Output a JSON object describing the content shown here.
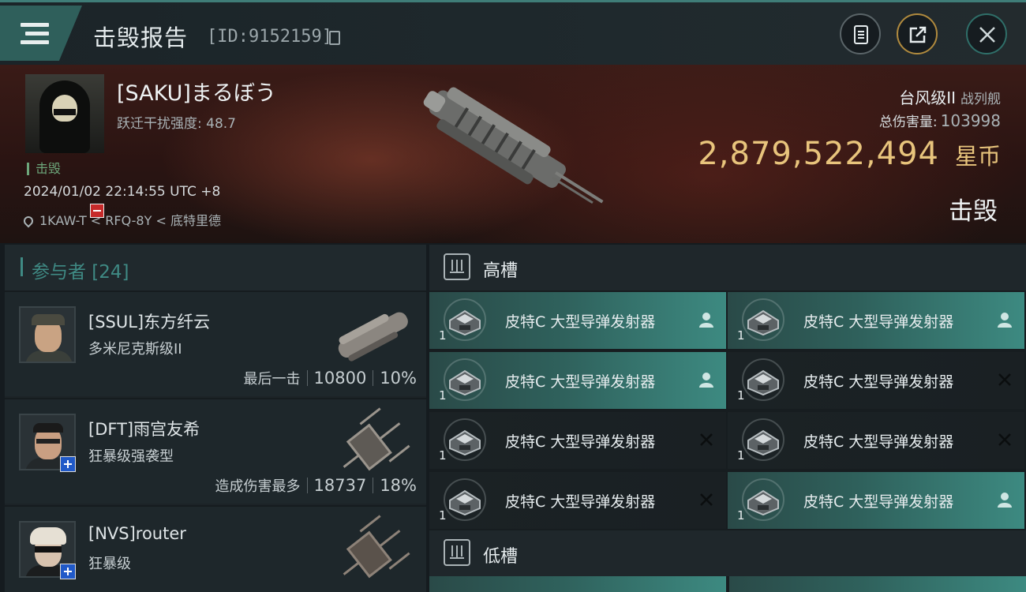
{
  "header": {
    "title": "击毁报告",
    "report_id": "[ID:9152159]",
    "buttons": [
      "clipboard-icon",
      "share-icon",
      "close-icon"
    ]
  },
  "victim": {
    "name": "[SAKU]まるぼう",
    "warp_scramble": "跃迁干扰强度: 48.7",
    "tag": "击毁",
    "timestamp": "2024/01/02 22:14:55 UTC +8",
    "location": "1KAW-T < RFQ-8Y < 底特里德",
    "ship_class": "台风级II",
    "ship_type": "战列舰",
    "total_damage_label": "总伤害量:",
    "total_damage": "103998",
    "isk_value": "2,879,522,494",
    "isk_unit": "星币",
    "status": "击毁"
  },
  "participants": {
    "header": "参与者 [24]",
    "items": [
      {
        "name": "[SSUL]东方纤云",
        "ship": "多米尼克斯级II",
        "label": "最后一击",
        "damage": "10800",
        "percent": "10%"
      },
      {
        "name": "[DFT]雨宫友希",
        "ship": "狂暴级强袭型",
        "label": "造成伤害最多",
        "damage": "18737",
        "percent": "18%"
      },
      {
        "name": "[NVS]router",
        "ship": "狂暴级",
        "label": "",
        "damage": "",
        "percent": ""
      }
    ]
  },
  "slots": {
    "high_label": "高槽",
    "low_label": "低槽",
    "high": [
      {
        "name": "皮特C 大型导弹发射器",
        "qty": "1",
        "state": "dropped"
      },
      {
        "name": "皮特C 大型导弹发射器",
        "qty": "1",
        "state": "dropped"
      },
      {
        "name": "皮特C 大型导弹发射器",
        "qty": "1",
        "state": "dropped"
      },
      {
        "name": "皮特C 大型导弹发射器",
        "qty": "1",
        "state": "destroyed"
      },
      {
        "name": "皮特C 大型导弹发射器",
        "qty": "1",
        "state": "destroyed"
      },
      {
        "name": "皮特C 大型导弹发射器",
        "qty": "1",
        "state": "destroyed"
      },
      {
        "name": "皮特C 大型导弹发射器",
        "qty": "1",
        "state": "destroyed"
      },
      {
        "name": "皮特C 大型导弹发射器",
        "qty": "1",
        "state": "dropped"
      }
    ]
  },
  "colors": {
    "accent": "#3f8a84",
    "isk": "#e8c47c",
    "kill_tag": "#6da77b"
  }
}
